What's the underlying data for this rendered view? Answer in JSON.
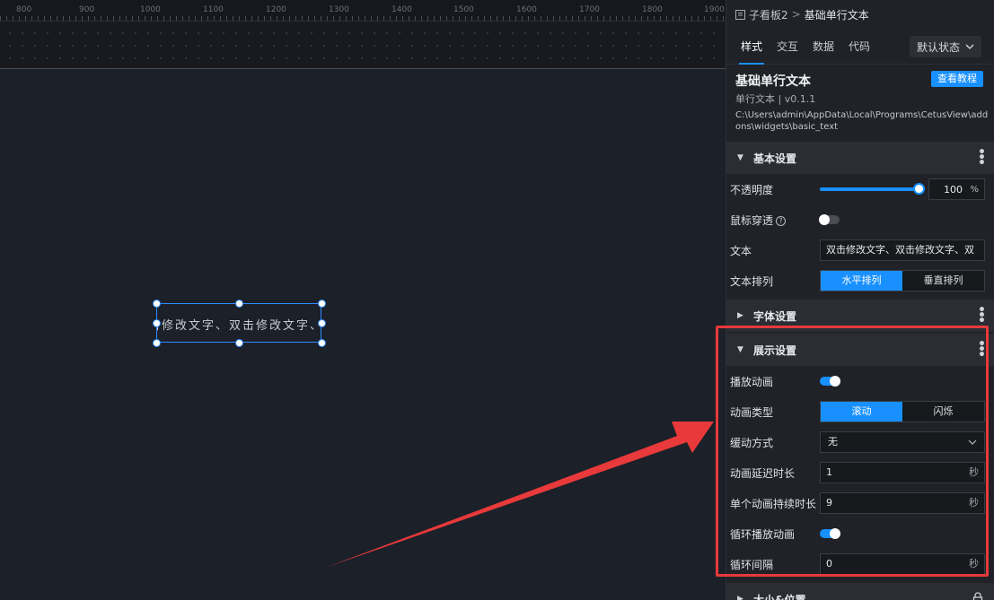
{
  "ruler": {
    "labels": [
      "800",
      "900",
      "1000",
      "1100",
      "1200",
      "1300",
      "1400",
      "1500",
      "1600",
      "1700",
      "1800",
      "1900"
    ]
  },
  "canvas": {
    "widget_text": "击修改文字、双击修改文字、双击"
  },
  "panel": {
    "breadcrumb": {
      "parent": "子看板2",
      "separator": ">",
      "current": "基础单行文本"
    },
    "tabs": [
      "样式",
      "交互",
      "数据",
      "代码"
    ],
    "state_select": "默认状态",
    "widget_title": "基础单行文本",
    "widget_subtitle": "单行文本 | v0.1.1",
    "widget_path": "C:\\Users\\admin\\AppData\\Local\\Programs\\CetusView\\addons\\widgets\\basic_text",
    "tutorial_button": "查看教程",
    "basic": {
      "title": "基本设置",
      "opacity_label": "不透明度",
      "opacity_value": "100",
      "opacity_unit": "%",
      "opacity_level": 1.0,
      "passthrough_label": "鼠标穿透",
      "help_glyph": "?",
      "text_label": "文本",
      "text_value": "双击修改文字、双击修改文字、双",
      "layout_label": "文本排列",
      "layout_options": [
        "水平排列",
        "垂直排列"
      ]
    },
    "font": {
      "title": "字体设置"
    },
    "display": {
      "title": "展示设置",
      "play_label": "播放动画",
      "anim_type_label": "动画类型",
      "anim_type_options": [
        "滚动",
        "闪烁"
      ],
      "easing_label": "缓动方式",
      "easing_value": "无",
      "delay_label": "动画延迟时长",
      "delay_value": "1",
      "duration_label": "单个动画持续时长",
      "duration_value": "9",
      "loop_label": "循环播放动画",
      "interval_label": "循环间隔",
      "interval_value": "0",
      "seconds_unit": "秒"
    },
    "size": {
      "title": "大小&位置"
    }
  },
  "colors": {
    "accent": "#1890ff",
    "highlight": "#e8393b"
  }
}
